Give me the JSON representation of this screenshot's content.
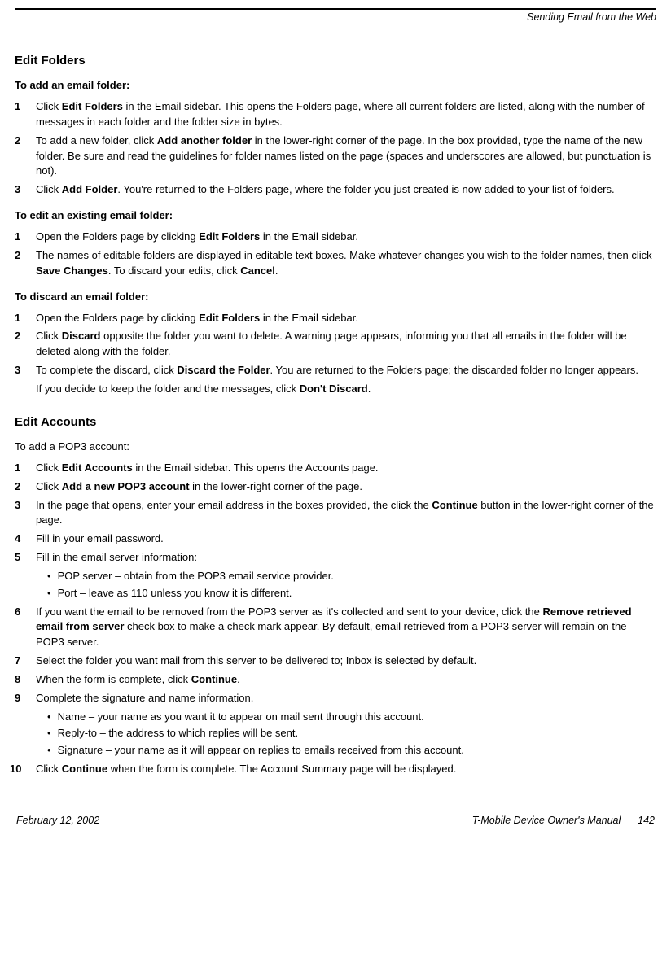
{
  "header": {
    "running_title": "Sending Email from the Web"
  },
  "section1": {
    "title": "Edit Folders",
    "sub1": {
      "title": "To add an email folder:",
      "steps": [
        {
          "pre": "Click ",
          "b": "Edit Folders",
          "post": " in the Email sidebar. This opens the Folders page, where all current folders are listed, along with the number of messages in each folder and the folder size in bytes."
        },
        {
          "pre": "To add a new folder, click ",
          "b": "Add another folder",
          "post": " in the lower-right corner of the page. In the box provided, type the name of the new folder. Be sure and read the guidelines for folder names listed on the page (spaces and underscores are allowed, but punctuation is not)."
        },
        {
          "pre": "Click ",
          "b": "Add Folder",
          "post": ". You're returned to the Folders page, where the folder you just created is now added to your list of folders."
        }
      ]
    },
    "sub2": {
      "title": "To edit an existing email folder:",
      "steps": [
        {
          "pre": "Open the Folders page by clicking ",
          "b": "Edit Folders",
          "post": " in the Email sidebar."
        },
        {
          "pre": "The names of editable folders are displayed in editable text boxes. Make whatever changes you wish to the folder names, then click ",
          "b": "Save Changes",
          "mid": ". To discard your edits, click ",
          "b2": "Cancel",
          "post": "."
        }
      ]
    },
    "sub3": {
      "title": "To discard an email folder:",
      "steps": [
        {
          "pre": "Open the Folders page by clicking ",
          "b": "Edit Folders",
          "post": " in the Email sidebar."
        },
        {
          "pre": "Click ",
          "b": "Discard",
          "post": " opposite the folder you want to delete. A warning page appears, informing you that all emails in the folder will be deleted along with the folder."
        },
        {
          "pre": "To complete the discard, click ",
          "b": "Discard the Folder",
          "post": ". You are returned to the Folders page; the discarded folder no longer appears.",
          "followup_pre": "If you decide to keep the folder and the messages, click ",
          "followup_b": "Don't Discard",
          "followup_post": "."
        }
      ]
    }
  },
  "section2": {
    "title": "Edit Accounts",
    "intro": "To add a POP3 account:",
    "steps": [
      {
        "pre": "Click ",
        "b": "Edit Accounts",
        "post": " in the Email sidebar. This opens the Accounts page."
      },
      {
        "pre": "Click ",
        "b": "Add a new POP3 account",
        "post": " in the lower-right corner of the page."
      },
      {
        "pre": "In the page that opens, enter your email address in the boxes provided, the click the ",
        "b": "Continue",
        "post": " button in the lower-right corner of the page."
      },
      {
        "pre": "Fill in your email password."
      },
      {
        "pre": "Fill in the email server information:",
        "bullets": [
          "POP server – obtain from the POP3 email service provider.",
          "Port – leave as 110 unless you know it is different."
        ]
      },
      {
        "pre": "If you want the email to be removed from the POP3 server as it's collected and sent to your device, click the ",
        "b": "Remove retrieved email from server",
        "post": " check box to make a check mark appear. By default, email retrieved from a POP3 server will remain on the POP3 server."
      },
      {
        "pre": "Select the folder you want mail from this server to be delivered to; Inbox is selected by default."
      },
      {
        "pre": "When the form is complete, click ",
        "b": "Continue",
        "post": "."
      },
      {
        "pre": "Complete the signature and name information.",
        "bullets": [
          "Name – your name as you want it to appear on mail sent through this account.",
          "Reply-to – the address to which replies will be sent.",
          "Signature – your name as it will appear on replies to emails received from this account."
        ]
      },
      {
        "pre": "Click ",
        "b": "Continue",
        "post": " when the form is complete. The Account Summary page will be displayed."
      }
    ]
  },
  "footer": {
    "date": "February 12, 2002",
    "title": "T-Mobile Device Owner's Manual",
    "page": "142"
  }
}
